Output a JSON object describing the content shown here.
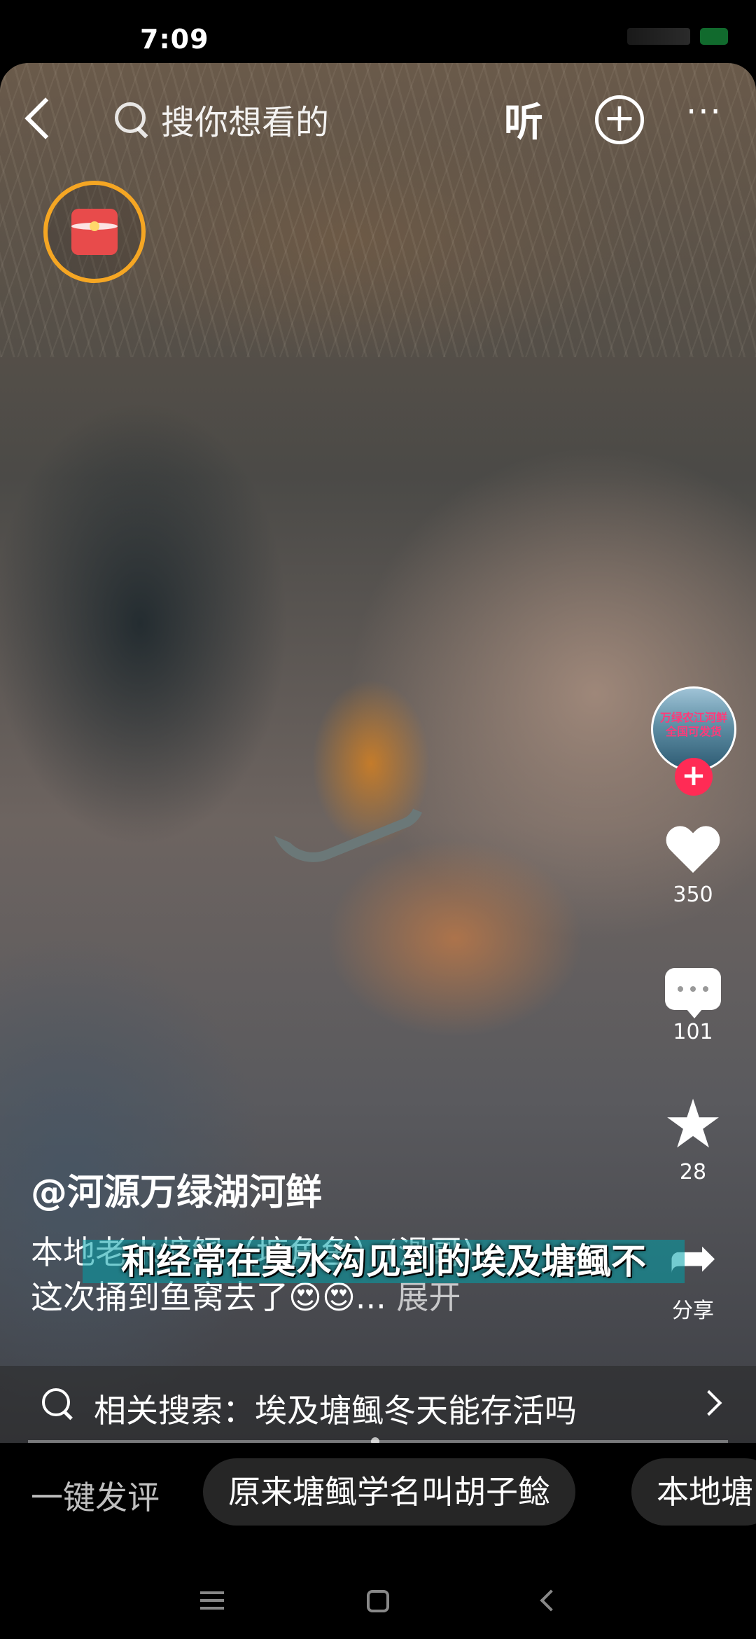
{
  "status_bar": {
    "time": "7:09"
  },
  "top_nav": {
    "search_placeholder": "搜你想看的",
    "listen_label": "听",
    "plus_label": "+",
    "more_label": "···"
  },
  "creator": {
    "avatar_text": "万绿农江河鲜 全国可发货"
  },
  "actions": {
    "follow_label": "+",
    "likes": "350",
    "comments": "101",
    "favorites": "28",
    "share_label": "分享"
  },
  "post": {
    "author": "@河源万绿湖河鲜",
    "description": "本地老水塘鲺（塘角鱼）(滑哥)",
    "description_line2": "这次捅到鱼窝去了😍😍...",
    "expand_label": "展开",
    "subtitle": "和经常在臭水沟见到的埃及塘鲺不"
  },
  "related_search": {
    "text": "相关搜索：埃及塘鲺冬天能存活吗"
  },
  "quick_comment": {
    "label": "一键发评",
    "chips": [
      "原来塘鲺学名叫胡子鲶",
      "本地塘"
    ]
  },
  "icons": {
    "back": "chevron-left-icon",
    "search": "search-icon",
    "like": "heart-icon",
    "comment": "comment-icon",
    "favorite": "star-icon",
    "share": "share-arrow-icon"
  },
  "colors": {
    "accent_red": "#ff2b55",
    "red_packet_ring": "#f5a623",
    "battery": "#22d45a"
  }
}
